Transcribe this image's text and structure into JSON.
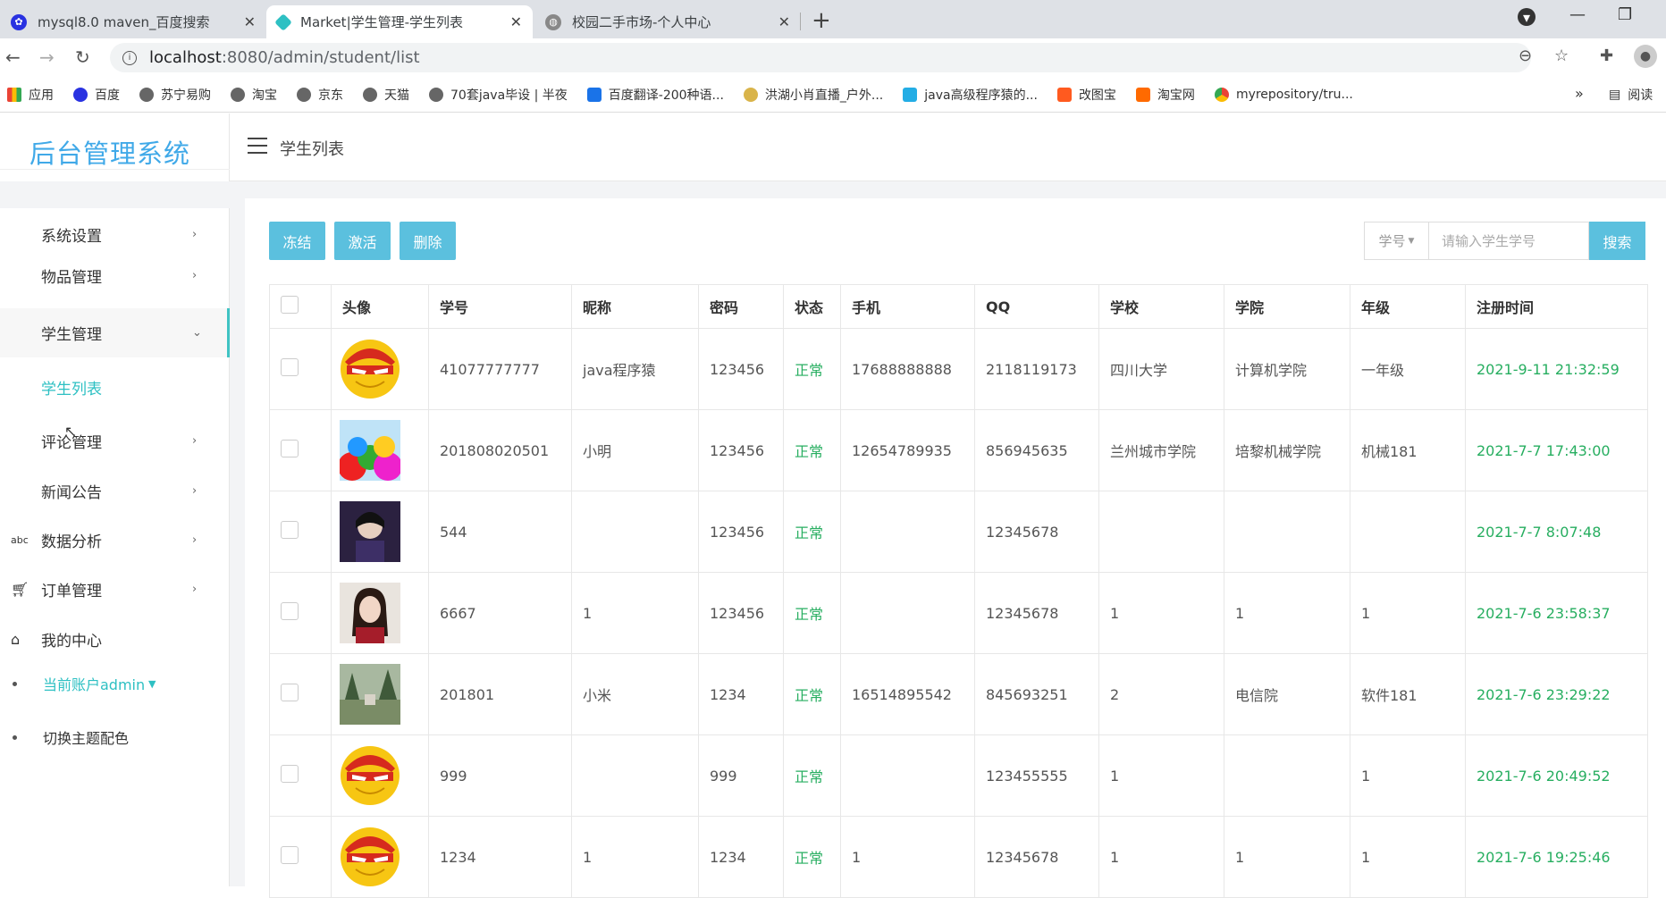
{
  "browser": {
    "tabs": [
      {
        "title": "mysql8.0 maven_百度搜索",
        "active": false,
        "favicon": "baidu-paw-icon"
      },
      {
        "title": "Market|学生管理-学生列表",
        "active": true,
        "favicon": "diamond-app-icon"
      },
      {
        "title": "校园二手市场-个人中心",
        "active": false,
        "favicon": "globe-icon"
      }
    ],
    "url_host": "localhost",
    "url_rest": ":8080/admin/student/list",
    "bookmarks": [
      {
        "label": "应用",
        "icon": "apps-grid-icon"
      },
      {
        "label": "百度",
        "icon": "baidu-paw-icon"
      },
      {
        "label": "苏宁易购",
        "icon": "globe-icon"
      },
      {
        "label": "淘宝",
        "icon": "globe-icon"
      },
      {
        "label": "京东",
        "icon": "globe-icon"
      },
      {
        "label": "天猫",
        "icon": "globe-icon"
      },
      {
        "label": "70套java毕设 | 半夜",
        "icon": "globe-icon"
      },
      {
        "label": "百度翻译-200种语...",
        "icon": "translate-icon"
      },
      {
        "label": "洪湖小肖直播_户外...",
        "icon": "feather-icon"
      },
      {
        "label": "java高级程序猿的...",
        "icon": "bilibili-icon"
      },
      {
        "label": "改图宝",
        "icon": "image-edit-icon"
      },
      {
        "label": "淘宝网",
        "icon": "taobao-icon"
      },
      {
        "label": "myrepository/tru...",
        "icon": "chrome-icon"
      }
    ],
    "bookmarks_more": "»",
    "reading_list": "阅读"
  },
  "app": {
    "brand": "后台管理系统",
    "page_title": "学生列表",
    "menu": [
      {
        "label": "系统设置",
        "chevron": "›"
      },
      {
        "label": "物品管理",
        "chevron": "›"
      },
      {
        "label": "学生管理",
        "chevron": "⌄"
      },
      {
        "label": "学生列表"
      },
      {
        "label": "评论管理",
        "chevron": "›"
      },
      {
        "label": "新闻公告",
        "chevron": "›"
      },
      {
        "label": "数据分析",
        "chevron": "›",
        "icon": "abc-icon"
      },
      {
        "label": "订单管理",
        "chevron": "›",
        "icon": "cart-icon"
      },
      {
        "label": "我的中心",
        "icon": "home-icon"
      }
    ],
    "account_label": "当前账户admin",
    "theme_label": "切换主题配色",
    "actions": {
      "freeze": "冻结",
      "activate": "激活",
      "delete": "删除"
    },
    "search": {
      "field": "学号",
      "placeholder": "请输入学生学号",
      "button": "搜索"
    },
    "columns": [
      "头像",
      "学号",
      "昵称",
      "密码",
      "状态",
      "手机",
      "QQ",
      "学校",
      "学院",
      "年级",
      "注册时间"
    ],
    "rows": [
      {
        "avatar": "ironman",
        "sn": "41077777777",
        "nick": "java程序猿",
        "pwd": "123456",
        "status": "正常",
        "phone": "17688888888",
        "qq": "2118119173",
        "school": "四川大学",
        "college": "计算机学院",
        "grade": "一年级",
        "time": "2021-9-11 21:32:59"
      },
      {
        "avatar": "balls",
        "sn": "201808020501",
        "nick": "小明",
        "pwd": "123456",
        "status": "正常",
        "phone": "12654789935",
        "qq": "856945635",
        "school": "兰州城市学院",
        "college": "培黎机械学院",
        "grade": "机械181",
        "time": "2021-7-7 17:43:00"
      },
      {
        "avatar": "person-dark",
        "sn": "544",
        "nick": "",
        "pwd": "123456",
        "status": "正常",
        "phone": "",
        "qq": "12345678",
        "school": "",
        "college": "",
        "grade": "",
        "time": "2021-7-7 8:07:48"
      },
      {
        "avatar": "person-girl",
        "sn": "6667",
        "nick": "1",
        "pwd": "123456",
        "status": "正常",
        "phone": "",
        "qq": "12345678",
        "school": "1",
        "college": "1",
        "grade": "1",
        "time": "2021-7-6 23:58:37"
      },
      {
        "avatar": "scenery",
        "sn": "201801",
        "nick": "小米",
        "pwd": "1234",
        "status": "正常",
        "phone": "16514895542",
        "qq": "845693251",
        "school": "2",
        "college": "电信院",
        "grade": "软件181",
        "time": "2021-7-6 23:29:22"
      },
      {
        "avatar": "ironman",
        "sn": "999",
        "nick": "",
        "pwd": "999",
        "status": "正常",
        "phone": "",
        "qq": "123455555",
        "school": "1",
        "college": "",
        "grade": "1",
        "time": "2021-7-6 20:49:52"
      },
      {
        "avatar": "ironman",
        "sn": "1234",
        "nick": "1",
        "pwd": "1234",
        "status": "正常",
        "phone": "1",
        "qq": "12345678",
        "school": "1",
        "college": "1",
        "grade": "1",
        "time": "2021-7-6 19:25:46"
      }
    ],
    "colors": {
      "accent": "#5bc0de",
      "brand": "#40a9e8",
      "active_menu": "#2ec0c3",
      "ok": "#27ae60"
    }
  }
}
